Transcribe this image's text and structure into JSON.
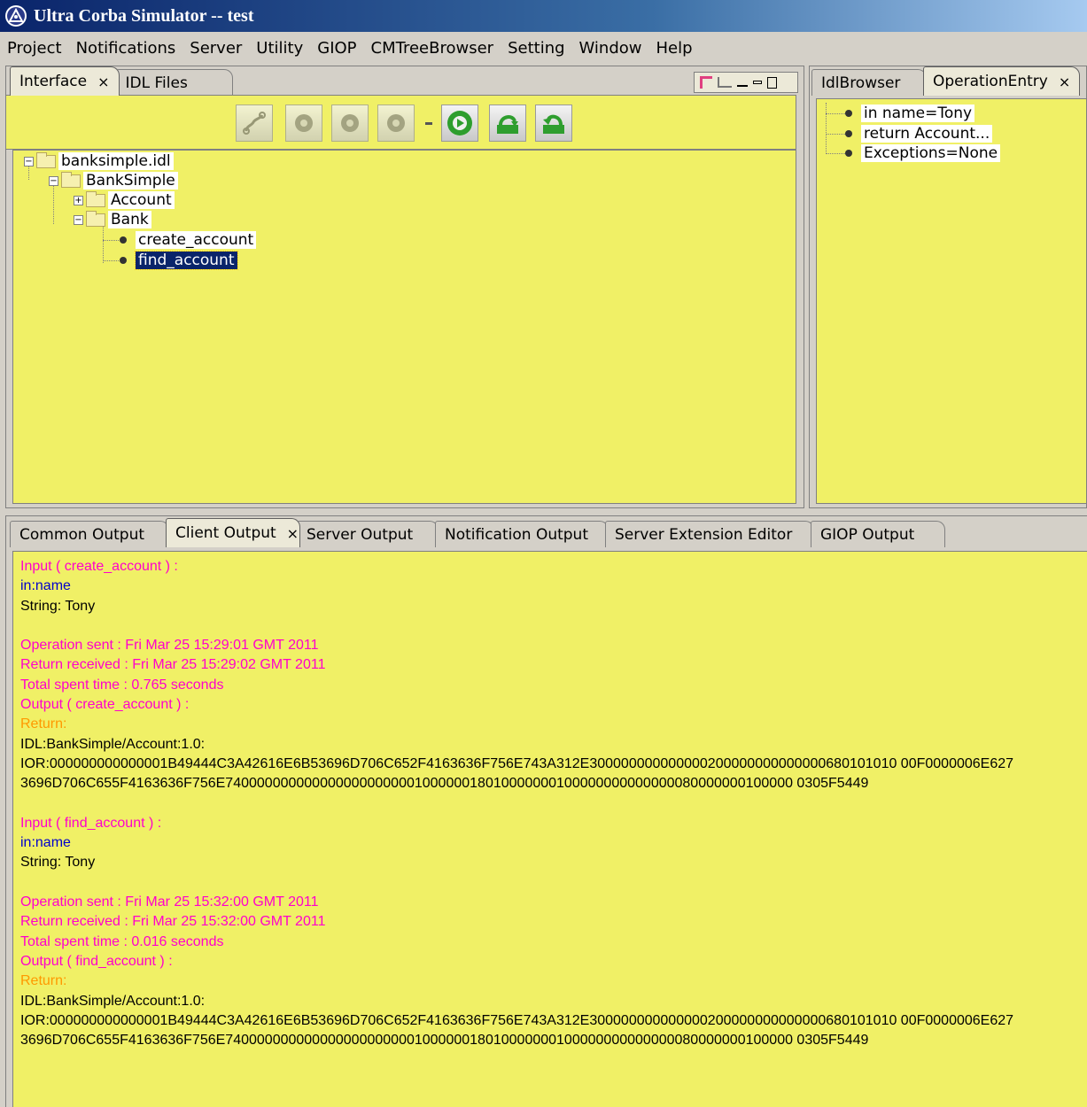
{
  "title": "Ultra Corba Simulator  -- test",
  "menu": [
    "Project",
    "Notifications",
    "Server",
    "Utility",
    "GIOP",
    "CMTreeBrowser",
    "Setting",
    "Window",
    "Help"
  ],
  "left_tabs": [
    {
      "label": "Interface",
      "close": "×"
    },
    {
      "label": "IDL Files"
    }
  ],
  "right_tabs": [
    {
      "label": "IdlBrowser"
    },
    {
      "label": "OperationEntry",
      "close": "×"
    }
  ],
  "tree": {
    "root": "banksimple.idl",
    "module": "BankSimple",
    "account": "Account",
    "bank": "Bank",
    "op1": "create_account",
    "op2": "find_account"
  },
  "operation_entry": [
    "in name=Tony",
    "return Account...",
    "Exceptions=None"
  ],
  "output_tabs": [
    {
      "label": "Common Output"
    },
    {
      "label": "Client Output",
      "close": "×"
    },
    {
      "label": "Server Output"
    },
    {
      "label": "Notification Output"
    },
    {
      "label": "Server Extension Editor"
    },
    {
      "label": "GIOP Output"
    }
  ],
  "output_lines": [
    {
      "text": "Input ( create_account ) :",
      "color": "pink"
    },
    {
      "text": "in:name",
      "color": "blue"
    },
    {
      "text": "String: Tony",
      "color": "black"
    },
    {
      "text": "",
      "color": "black"
    },
    {
      "text": "Operation sent : Fri Mar 25 15:29:01 GMT 2011",
      "color": "pink"
    },
    {
      "text": "Return received : Fri Mar 25 15:29:02 GMT 2011",
      "color": "pink"
    },
    {
      "text": "Total spent time : 0.765 seconds",
      "color": "pink"
    },
    {
      "text": "Output ( create_account ) :",
      "color": "pink"
    },
    {
      "text": "Return:",
      "color": "orange"
    },
    {
      "text": "IDL:BankSimple/Account:1.0:",
      "color": "black"
    },
    {
      "text": "IOR:000000000000001B49444C3A42616E6B53696D706C652F4163636F756E743A312E300000000000000200000000000000680101010 00F0000006E627",
      "color": "black"
    },
    {
      "text": "3696D706C655F4163636F756E740000000000000000000000100000018010000000100000000000000080000000100000 0305F5449",
      "color": "black"
    },
    {
      "text": "",
      "color": "black"
    },
    {
      "text": "Input ( find_account ) :",
      "color": "pink"
    },
    {
      "text": "in:name",
      "color": "blue"
    },
    {
      "text": "String: Tony",
      "color": "black"
    },
    {
      "text": "",
      "color": "black"
    },
    {
      "text": "Operation sent : Fri Mar 25 15:32:00 GMT 2011",
      "color": "pink"
    },
    {
      "text": "Return received : Fri Mar 25 15:32:00 GMT 2011",
      "color": "pink"
    },
    {
      "text": "Total spent time : 0.016 seconds",
      "color": "pink"
    },
    {
      "text": "Output ( find_account ) :",
      "color": "pink"
    },
    {
      "text": "Return:",
      "color": "orange"
    },
    {
      "text": "IDL:BankSimple/Account:1.0:",
      "color": "black"
    },
    {
      "text": "IOR:000000000000001B49444C3A42616E6B53696D706C652F4163636F756E743A312E300000000000000200000000000000680101010 00F0000006E627",
      "color": "black"
    },
    {
      "text": "3696D706C655F4163636F756E740000000000000000000000100000018010000000100000000000000080000000100000 0305F5449",
      "color": "black"
    }
  ]
}
